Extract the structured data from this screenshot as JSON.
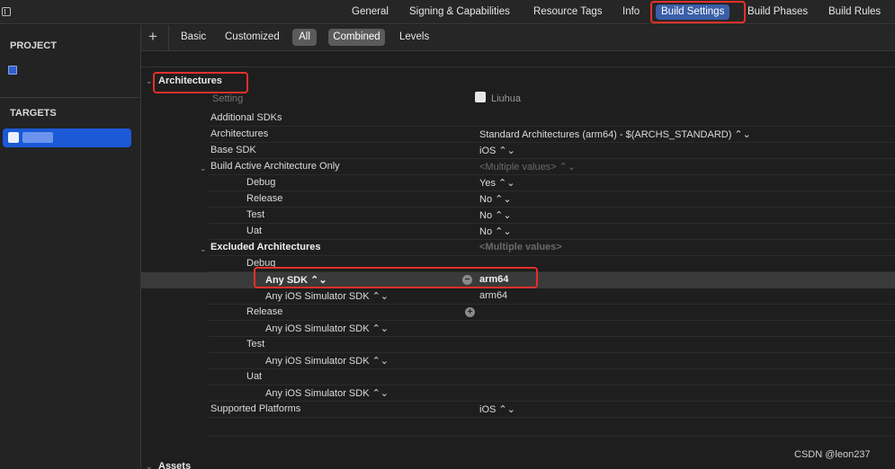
{
  "tabs": {
    "general": "General",
    "signing": "Signing & Capabilities",
    "resource_tags": "Resource Tags",
    "info": "Info",
    "build_settings": "Build Settings",
    "build_phases": "Build Phases",
    "build_rules": "Build Rules"
  },
  "sidebar": {
    "project_header": "PROJECT",
    "targets_header": "TARGETS"
  },
  "filters": {
    "add": "+",
    "basic": "Basic",
    "customized": "Customized",
    "all": "All",
    "combined": "Combined",
    "levels": "Levels"
  },
  "sections": {
    "architectures": "Architectures",
    "assets": "Assets"
  },
  "columns": {
    "setting": "Setting",
    "target_name": "Liuhua"
  },
  "rows": {
    "additional_sdks": "Additional SDKs",
    "architectures": "Architectures",
    "architectures_value": "Standard Architectures (arm64)  -  $(ARCHS_STANDARD) ⌃⌄",
    "base_sdk": "Base SDK",
    "base_sdk_value": "iOS ⌃⌄",
    "build_active": "Build Active Architecture Only",
    "build_active_value": "<Multiple values> ⌃⌄",
    "debug": "Debug",
    "debug_value": "Yes ⌃⌄",
    "release": "Release",
    "release_value": "No ⌃⌄",
    "test": "Test",
    "test_value": "No ⌃⌄",
    "uat": "Uat",
    "uat_value": "No ⌃⌄",
    "excluded": "Excluded Architectures",
    "excluded_value": "<Multiple values>",
    "ex_debug": "Debug",
    "any_sdk": "Any SDK ⌃⌄",
    "any_sdk_value": "arm64",
    "sim_debug": "Any iOS Simulator SDK ⌃⌄",
    "sim_debug_value": "arm64",
    "ex_release": "Release",
    "sim_release": "Any iOS Simulator SDK ⌃⌄",
    "ex_test": "Test",
    "sim_test": "Any iOS Simulator SDK ⌃⌄",
    "ex_uat": "Uat",
    "sim_uat": "Any iOS Simulator SDK ⌃⌄",
    "supported_platforms": "Supported Platforms",
    "supported_platforms_value": "iOS ⌃⌄"
  },
  "icons": {
    "minus": "−",
    "plus": "+",
    "chevron": "⌄"
  },
  "watermark": "CSDN @leon237",
  "colors": {
    "accent": "#3a5fa8",
    "selection": "#1b59d6",
    "annotation": "#e5302a"
  }
}
